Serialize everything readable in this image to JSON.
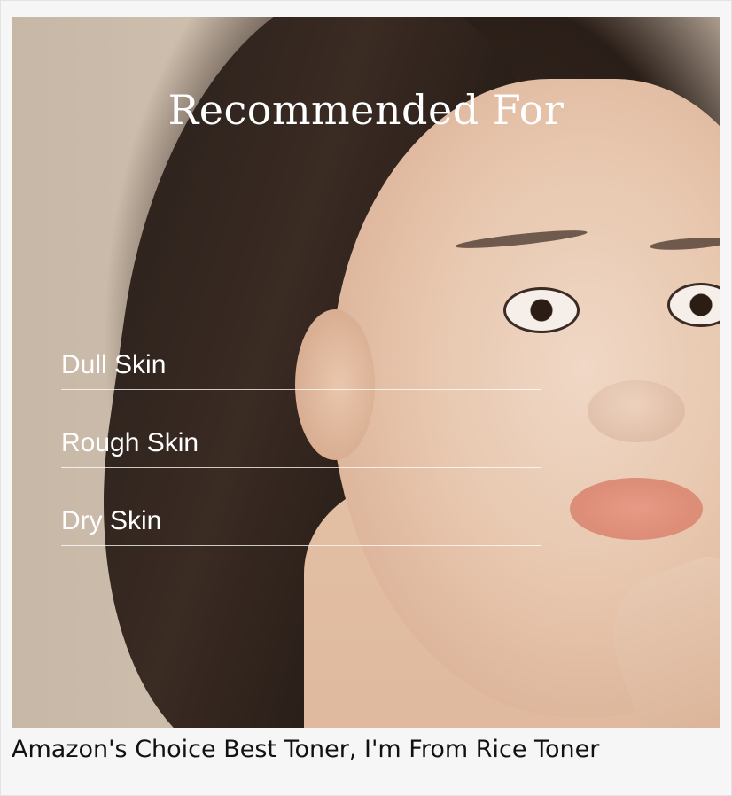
{
  "hero": {
    "title": "Recommended For",
    "items": [
      {
        "label": "Dull Skin"
      },
      {
        "label": "Rough Skin"
      },
      {
        "label": "Dry Skin"
      }
    ]
  },
  "caption": "Amazon's Choice Best Toner, I'm From Rice Toner",
  "colors": {
    "background": "#f6f6f6",
    "hero_text": "#ffffff",
    "caption_text": "#111111"
  }
}
